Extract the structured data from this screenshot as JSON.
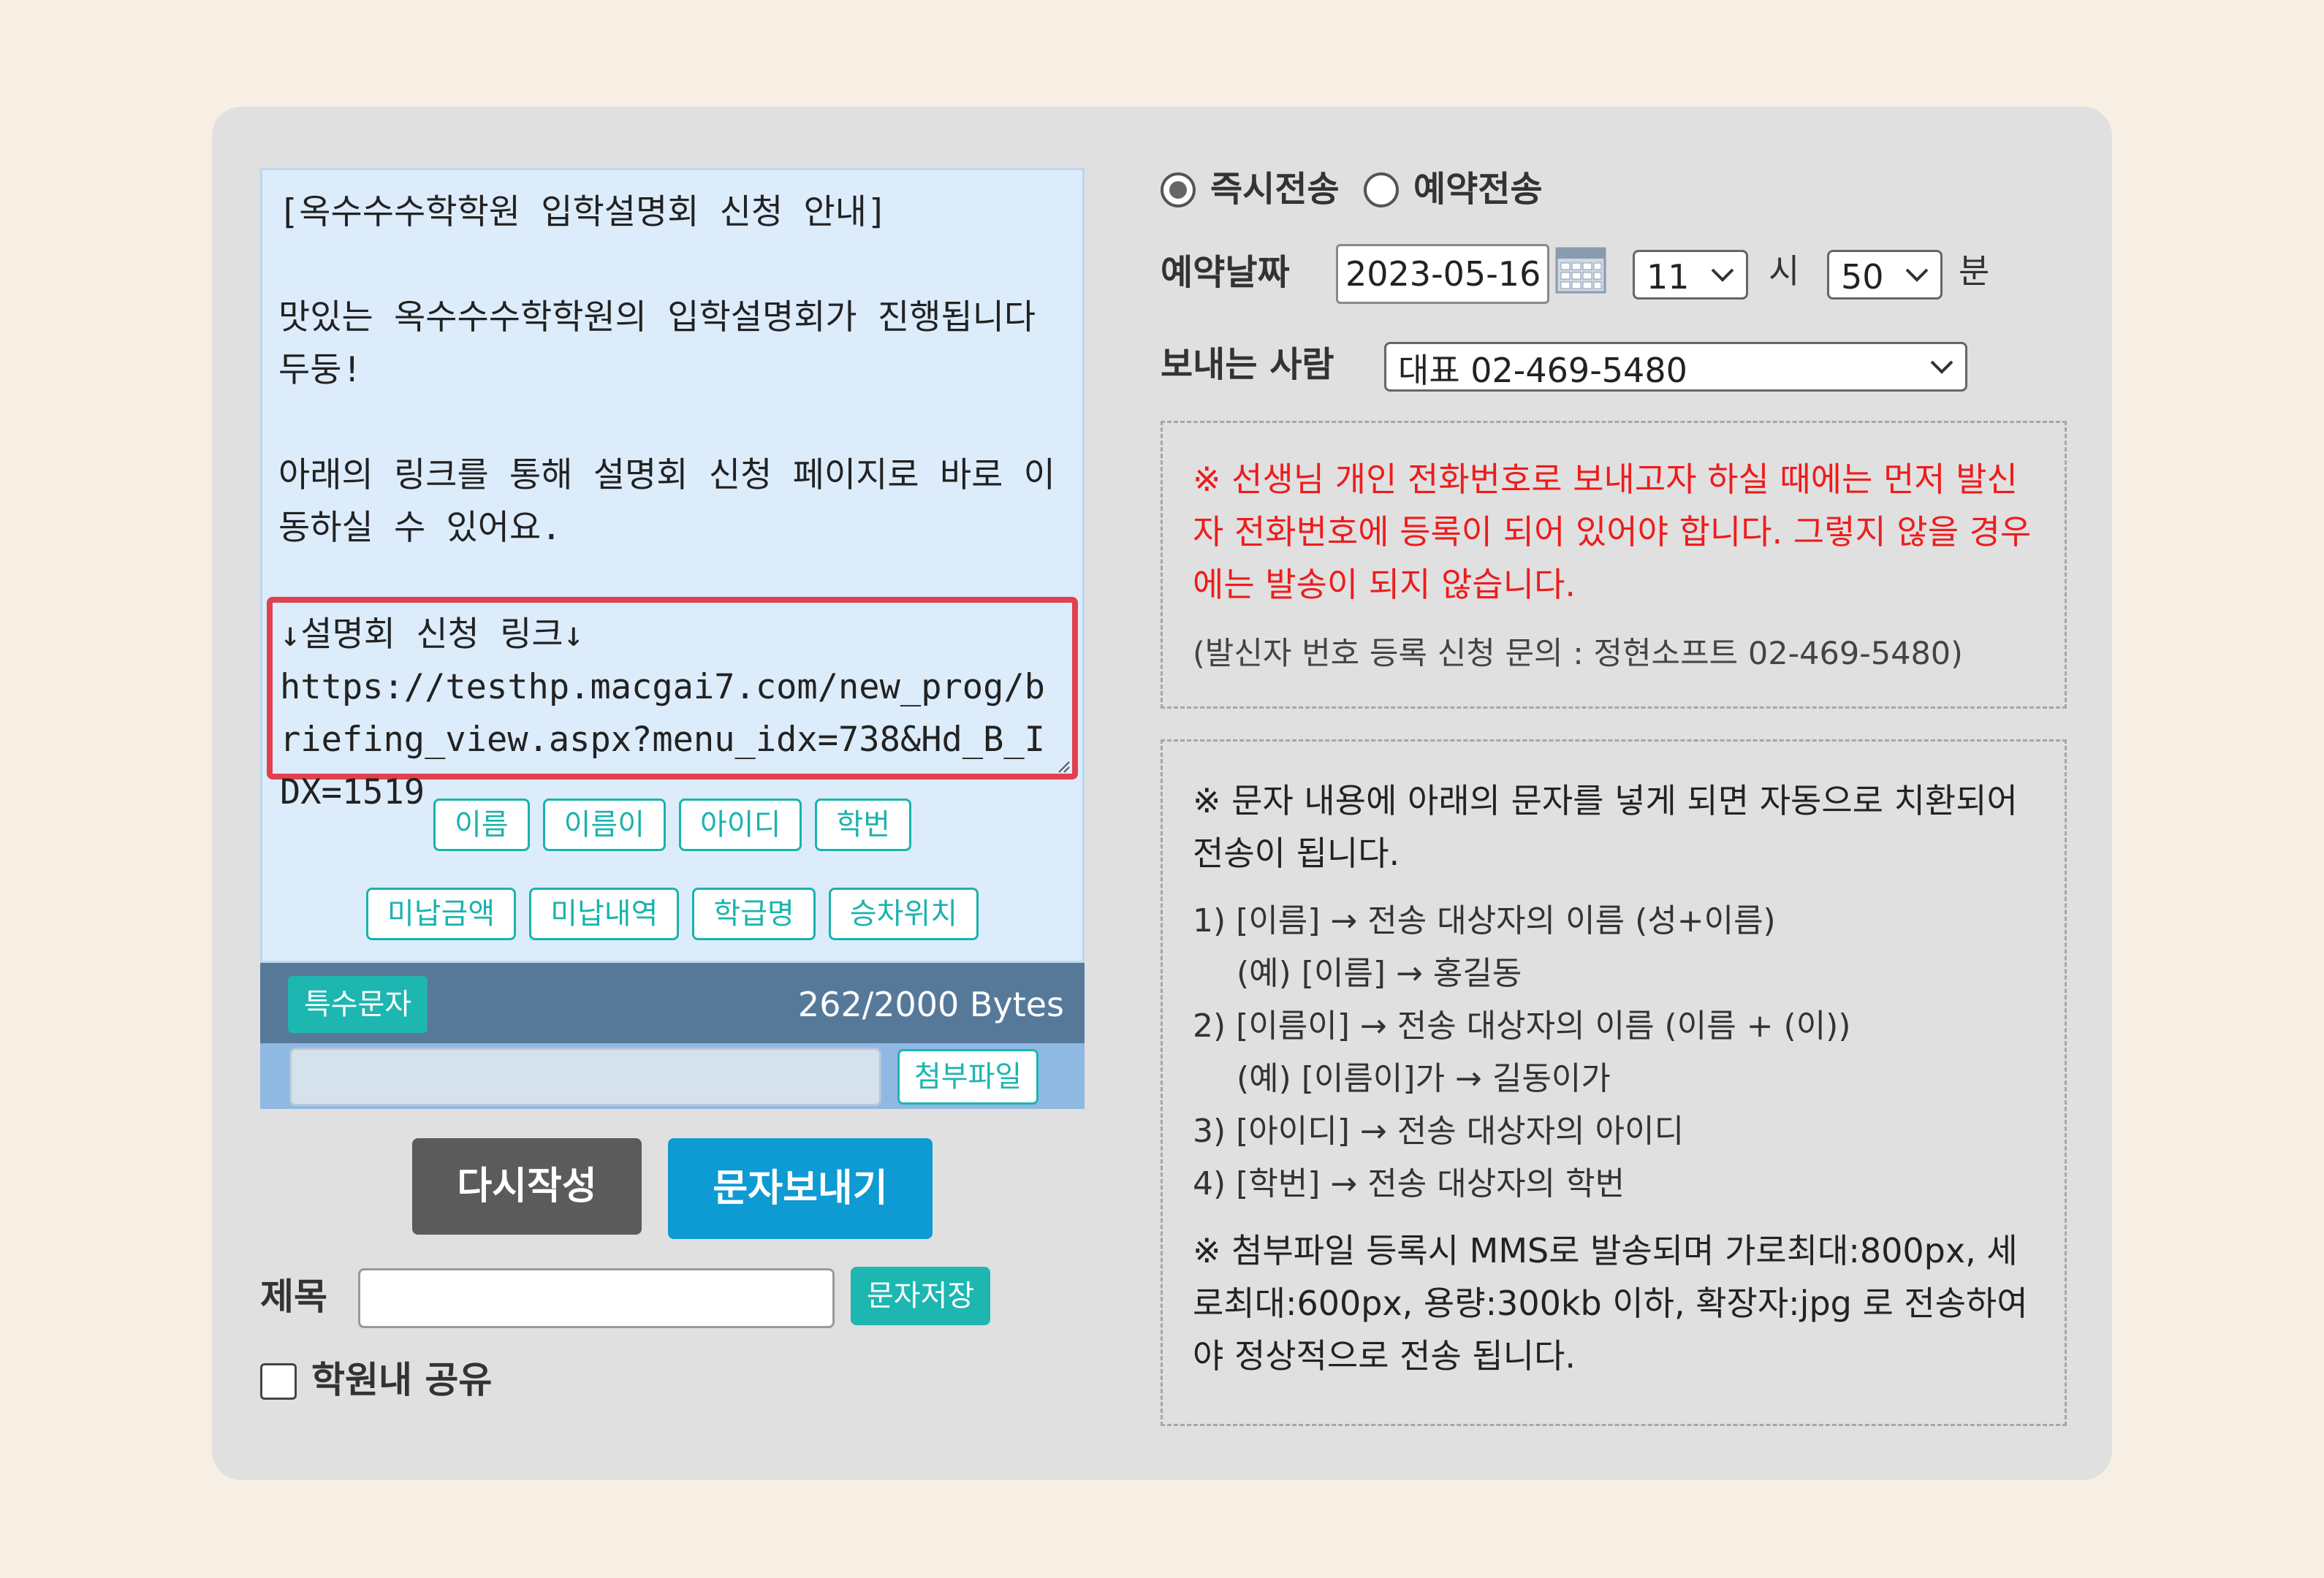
{
  "message": {
    "body": "[옥수수수학학원 입학설명회 신청 안내]\n\n맛있는 옥수수수학학원의 입학설명회가 진행됩니다 두둥!\n\n아래의 링크를 통해 설명회 신청 페이지로 바로 이동하실 수 있어요.",
    "link_block": "↓설명회 신청 링크↓\nhttps://testhp.macgai7.com/new_prog/briefing_view.aspx?menu_idx=738&Hd_B_IDX=1519"
  },
  "chips_row1": [
    "이름",
    "이름이",
    "아이디",
    "학번"
  ],
  "chips_row2": [
    "미납금액",
    "미납내역",
    "학급명",
    "승차위치"
  ],
  "toolbar": {
    "special_chars": "특수문자",
    "bytes": "262/2000 Bytes",
    "attach": "첨부파일"
  },
  "actions": {
    "rewrite": "다시작성",
    "send": "문자보내기",
    "subject_label": "제목",
    "save": "문자저장",
    "share_label": "학원내 공유"
  },
  "send_options": {
    "immediate": "즉시전송",
    "scheduled": "예약전송",
    "selected": "immediate"
  },
  "schedule": {
    "date_label": "예약날짜",
    "date": "2023-05-16",
    "hour": "11",
    "hour_unit": "시",
    "minute": "50",
    "minute_unit": "분"
  },
  "sender": {
    "label": "보내는 사람",
    "value": "대표 02-469-5480"
  },
  "notice": {
    "warning": "※ 선생님 개인 전화번호로 보내고자 하실 때에는 먼저 발신자 전화번호에 등록이 되어 있어야 합니다. 그렇지 않을 경우에는 발송이 되지 않습니다.",
    "contact": "(발신자 번호 등록 신청 문의 : 정현소프트 02-469-5480)"
  },
  "info": {
    "title": "※ 문자 내용에 아래의 문자를 넣게 되면 자동으로 치환되어 전송이 됩니다.",
    "lines": [
      "1) [이름] → 전송 대상자의 이름 (성+이름)",
      "(예) [이름] → 홍길동",
      "2) [이름이] → 전송 대상자의 이름 (이름 + (이))",
      "(예) [이름이]가 → 길동이가",
      "3) [아이디] → 전송 대상자의 아이디",
      "4) [학번] → 전송 대상자의 학번"
    ],
    "attach_note": "※ 첨부파일 등록시 MMS로 발송되며 가로최대:800px, 세로최대:600px, 용량:300kb 이하, 확장자:jpg 로 전송하여야 정상적으로 전송 됩니다."
  },
  "colors": {
    "accent_teal": "#1db6b0",
    "send_blue": "#0e9ad2",
    "warning_red": "#ee1c1c",
    "link_border": "#e2404f"
  }
}
